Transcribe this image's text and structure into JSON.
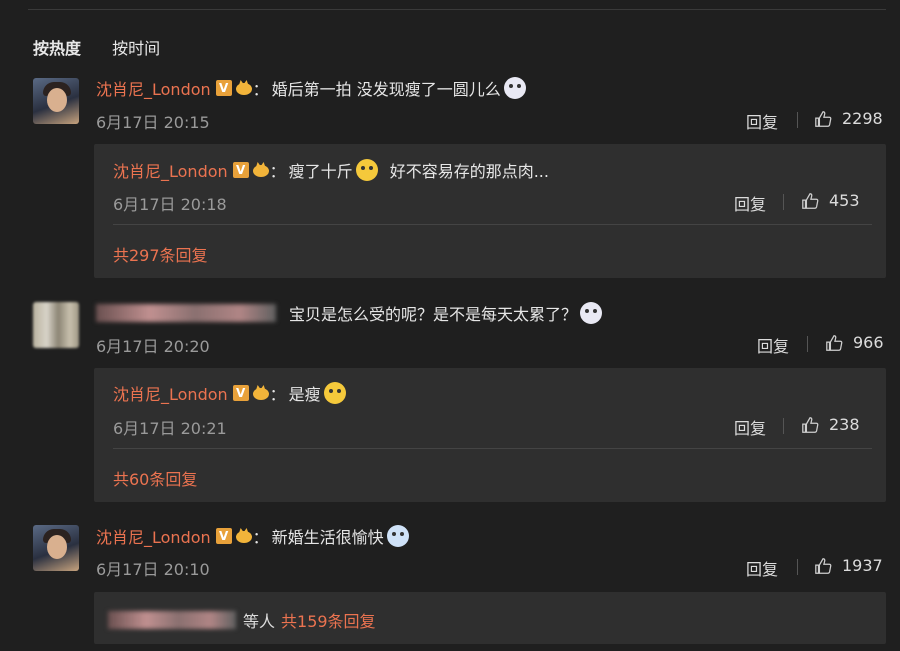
{
  "sort": {
    "hot": "按热度",
    "time": "按时间"
  },
  "common": {
    "reply": "回复"
  },
  "comments": [
    {
      "user": "沈肖尼_London",
      "colon": "：",
      "text": "婚后第一拍 没发现瘦了一圆儿么",
      "time": "6月17日 20:15",
      "likes": "2298",
      "reply": {
        "user": "沈肖尼_London",
        "colon": "：",
        "text": "瘦了十斤",
        "text2": "好不容易存的那点肉...",
        "time": "6月17日 20:18",
        "likes": "453"
      },
      "more": "共297条回复"
    },
    {
      "user_blurred": true,
      "colon": "：",
      "text": "宝贝是怎么受的呢？是不是每天太累了？",
      "time": "6月17日 20:20",
      "likes": "966",
      "reply": {
        "user": "沈肖尼_London",
        "colon": "：",
        "text": "是瘦",
        "time": "6月17日 20:21",
        "likes": "238"
      },
      "more": "共60条回复"
    },
    {
      "user": "沈肖尼_London",
      "colon": "：",
      "text": "新婚生活很愉快",
      "time": "6月17日 20:10",
      "likes": "1937",
      "more_prefix": "等人",
      "more": "共159条回复"
    }
  ],
  "badge": {
    "v": "V"
  },
  "colors": {
    "username": "#eb7350",
    "background": "#1f1f1f",
    "card": "#2f2f2f"
  }
}
